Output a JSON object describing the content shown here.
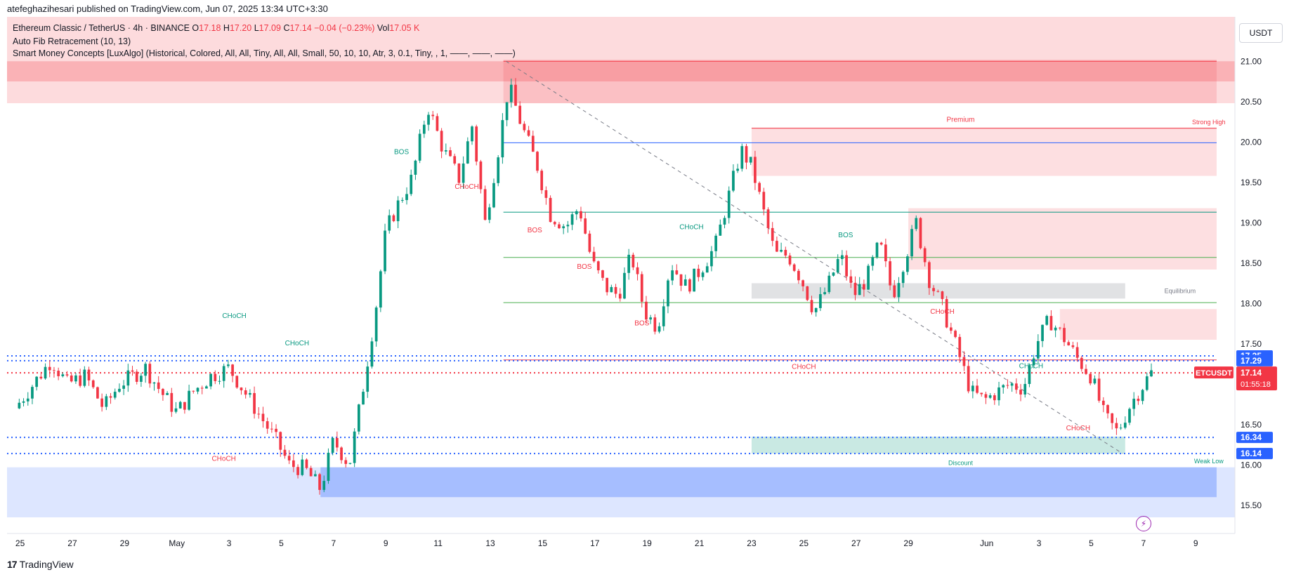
{
  "header": {
    "publisher": "atefeghazihesari published on TradingView.com, Jun 07, 2025 13:34 UTC+3:30"
  },
  "legend": {
    "symbol_line": "Ethereum Classic / TetherUS · 4h · BINANCE",
    "o_label": "O",
    "o_value": "17.18",
    "h_label": "H",
    "h_value": "17.20",
    "l_label": "L",
    "l_value": "17.09",
    "c_label": "C",
    "c_value": "17.14",
    "change": "−0.04 (−0.23%)",
    "vol_label": "Vol",
    "vol_value": "17.05 K",
    "indicator1": "Auto Fib Retracement (10, 13)",
    "indicator2": "Smart Money Concepts [LuxAlgo] (Historical, Colored, All, All, Tiny, All, All, Small, 50, 10, 10, Atr, 3, 0.1, Tiny, , 1, ——, ——, ——)"
  },
  "currency_button": "USDT",
  "brand": {
    "logo": "17",
    "name": "TradingView"
  },
  "colors": {
    "up": "#089981",
    "down": "#f23645",
    "fib": "#2962ff",
    "premium": "#f23645",
    "discount": "#089981"
  },
  "chart_data": {
    "type": "candlestick",
    "symbol": "ETCUSDT",
    "interval": "4h",
    "ylim": [
      15.15,
      21.55
    ],
    "y_ticks": [
      "15.50",
      "16.00",
      "16.50",
      "17.00",
      "17.50",
      "18.00",
      "18.50",
      "19.00",
      "19.50",
      "20.00",
      "20.50",
      "21.00"
    ],
    "x_ticks": [
      {
        "label": "25",
        "day": -5
      },
      {
        "label": "27",
        "day": -3
      },
      {
        "label": "29",
        "day": -1
      },
      {
        "label": "May",
        "day": 1
      },
      {
        "label": "3",
        "day": 3
      },
      {
        "label": "5",
        "day": 5
      },
      {
        "label": "7",
        "day": 7
      },
      {
        "label": "9",
        "day": 9
      },
      {
        "label": "11",
        "day": 11
      },
      {
        "label": "13",
        "day": 13
      },
      {
        "label": "15",
        "day": 15
      },
      {
        "label": "17",
        "day": 17
      },
      {
        "label": "19",
        "day": 19
      },
      {
        "label": "21",
        "day": 21
      },
      {
        "label": "23",
        "day": 23
      },
      {
        "label": "25",
        "day": 25
      },
      {
        "label": "27",
        "day": 27
      },
      {
        "label": "29",
        "day": 29
      },
      {
        "label": "Jun",
        "day": 32
      },
      {
        "label": "3",
        "day": 34
      },
      {
        "label": "5",
        "day": 36
      },
      {
        "label": "7",
        "day": 38
      },
      {
        "label": "9",
        "day": 40
      }
    ],
    "price_path": [
      [
        -5.2,
        16.7
      ],
      [
        -4.5,
        17.0
      ],
      [
        -3.8,
        17.3
      ],
      [
        -3.2,
        17.0
      ],
      [
        -2.5,
        17.1
      ],
      [
        -1.8,
        16.7
      ],
      [
        -1.2,
        17.0
      ],
      [
        -0.2,
        17.2
      ],
      [
        0.4,
        16.9
      ],
      [
        1.0,
        16.65
      ],
      [
        1.6,
        16.9
      ],
      [
        2.3,
        17.1
      ],
      [
        3.0,
        17.2
      ],
      [
        3.6,
        16.9
      ],
      [
        4.2,
        16.6
      ],
      [
        4.8,
        16.3
      ],
      [
        5.3,
        16.0
      ],
      [
        5.9,
        15.95
      ],
      [
        6.5,
        15.7
      ],
      [
        7.0,
        16.3
      ],
      [
        7.6,
        16.0
      ],
      [
        8.1,
        16.9
      ],
      [
        8.6,
        17.9
      ],
      [
        9.0,
        18.9
      ],
      [
        9.5,
        19.25
      ],
      [
        10.0,
        19.55
      ],
      [
        10.6,
        20.45
      ],
      [
        11.2,
        19.9
      ],
      [
        11.8,
        19.55
      ],
      [
        12.3,
        20.2
      ],
      [
        12.8,
        19.0
      ],
      [
        13.3,
        19.9
      ],
      [
        13.7,
        20.7
      ],
      [
        14.2,
        20.2
      ],
      [
        14.8,
        19.7
      ],
      [
        15.3,
        19.1
      ],
      [
        15.9,
        18.95
      ],
      [
        16.4,
        19.2
      ],
      [
        16.9,
        18.5
      ],
      [
        17.4,
        18.2
      ],
      [
        17.9,
        18.1
      ],
      [
        18.4,
        18.6
      ],
      [
        18.9,
        17.9
      ],
      [
        19.4,
        17.7
      ],
      [
        19.9,
        18.5
      ],
      [
        20.5,
        18.2
      ],
      [
        21.0,
        18.4
      ],
      [
        21.6,
        18.7
      ],
      [
        22.1,
        19.3
      ],
      [
        22.6,
        19.9
      ],
      [
        23.0,
        19.7
      ],
      [
        23.4,
        19.2
      ],
      [
        23.9,
        18.6
      ],
      [
        24.4,
        18.6
      ],
      [
        24.9,
        18.3
      ],
      [
        25.4,
        17.9
      ],
      [
        25.9,
        18.2
      ],
      [
        26.4,
        18.6
      ],
      [
        26.9,
        18.1
      ],
      [
        27.4,
        18.3
      ],
      [
        27.9,
        18.75
      ],
      [
        28.4,
        18.1
      ],
      [
        28.9,
        18.6
      ],
      [
        29.3,
        19.0
      ],
      [
        29.8,
        18.3
      ],
      [
        30.3,
        17.95
      ],
      [
        30.9,
        17.4
      ],
      [
        31.4,
        16.9
      ],
      [
        31.9,
        16.8
      ],
      [
        32.4,
        16.9
      ],
      [
        32.9,
        17.0
      ],
      [
        33.4,
        16.95
      ],
      [
        33.9,
        17.5
      ],
      [
        34.4,
        17.8
      ],
      [
        34.9,
        17.6
      ],
      [
        35.5,
        17.3
      ],
      [
        36.0,
        17.1
      ],
      [
        36.5,
        16.6
      ],
      [
        37.0,
        16.4
      ],
      [
        37.5,
        16.75
      ],
      [
        38.0,
        17.0
      ],
      [
        38.3,
        17.14
      ]
    ],
    "last_price": {
      "label": "ETCUSDT",
      "value": "17.14",
      "countdown": "01:55:18"
    },
    "price_tags": [
      {
        "value": "17.35",
        "y": 17.35
      },
      {
        "value": "17.29",
        "y": 17.29
      },
      {
        "value": "16.34",
        "y": 16.34
      },
      {
        "value": "16.14",
        "y": 16.14
      }
    ],
    "zones": [
      {
        "kind": "supply",
        "x0": 13.5,
        "x1": 40.8,
        "y0": 20.48,
        "y1": 21.02
      },
      {
        "kind": "supply",
        "x0": 23.0,
        "x1": 40.8,
        "y0": 19.58,
        "y1": 20.18
      },
      {
        "kind": "supply",
        "x0": 29.0,
        "x1": 40.8,
        "y0": 18.42,
        "y1": 19.18
      },
      {
        "kind": "supply",
        "x0": 34.8,
        "x1": 40.8,
        "y0": 17.55,
        "y1": 17.93
      },
      {
        "kind": "equilibrium",
        "x0": 23.0,
        "x1": 37.3,
        "y0": 18.06,
        "y1": 18.25
      },
      {
        "kind": "discount",
        "x0": 23.0,
        "x1": 37.3,
        "y0": 16.14,
        "y1": 16.35
      },
      {
        "kind": "demand",
        "x0": 6.5,
        "x1": 40.8,
        "y0": 15.6,
        "y1": 15.97
      }
    ],
    "levels": [
      {
        "y": 21.0,
        "x0": 13.5,
        "x1": 40.8,
        "color": "#f23645",
        "style": "solid"
      },
      {
        "y": 20.17,
        "x0": 23.0,
        "x1": 40.8,
        "color": "#f23645",
        "style": "solid"
      },
      {
        "y": 19.99,
        "x0": 13.5,
        "x1": 40.8,
        "color": "#2962ff",
        "style": "solid"
      },
      {
        "y": 19.13,
        "x0": 13.5,
        "x1": 40.8,
        "color": "#089981",
        "style": "solid"
      },
      {
        "y": 18.57,
        "x0": 13.5,
        "x1": 40.8,
        "color": "#4caf50",
        "style": "solid"
      },
      {
        "y": 18.01,
        "x0": 13.5,
        "x1": 40.8,
        "color": "#4caf50",
        "style": "solid"
      },
      {
        "y": 17.3,
        "x0": 13.5,
        "x1": 40.8,
        "color": "#f23645",
        "style": "solid"
      },
      {
        "y": 17.35,
        "x0": -5.5,
        "x1": 40.8,
        "color": "#2962ff",
        "style": "dotted"
      },
      {
        "y": 17.29,
        "x0": -5.5,
        "x1": 40.8,
        "color": "#2962ff",
        "style": "dotted"
      },
      {
        "y": 16.34,
        "x0": -5.5,
        "x1": 40.8,
        "color": "#2962ff",
        "style": "dotted"
      },
      {
        "y": 16.14,
        "x0": -5.5,
        "x1": 40.8,
        "color": "#2962ff",
        "style": "dotted"
      },
      {
        "y": 17.14,
        "x0": -5.5,
        "x1": 40.8,
        "color": "#f23645",
        "style": "dotted"
      }
    ],
    "diagonal": {
      "from": [
        13.6,
        21.0
      ],
      "to": [
        37.2,
        16.14
      ]
    },
    "annotations": [
      {
        "text": "CHoCH",
        "x": 3.2,
        "y": 17.82,
        "color": "#089981"
      },
      {
        "text": "CHoCH",
        "x": 5.6,
        "y": 17.48,
        "color": "#089981"
      },
      {
        "text": "CHoCH",
        "x": 2.8,
        "y": 16.05,
        "color": "#f23645"
      },
      {
        "text": "BOS",
        "x": 9.6,
        "y": 19.85,
        "color": "#089981"
      },
      {
        "text": "CHoCH",
        "x": 12.1,
        "y": 19.42,
        "color": "#f23645"
      },
      {
        "text": "BOS",
        "x": 14.7,
        "y": 18.88,
        "color": "#f23645"
      },
      {
        "text": "BOS",
        "x": 16.6,
        "y": 18.43,
        "color": "#f23645"
      },
      {
        "text": "BOS",
        "x": 18.8,
        "y": 17.73,
        "color": "#f23645"
      },
      {
        "text": "CHoCH",
        "x": 20.7,
        "y": 18.92,
        "color": "#089981"
      },
      {
        "text": "BOS",
        "x": 26.6,
        "y": 18.82,
        "color": "#089981"
      },
      {
        "text": "CHoCH",
        "x": 30.3,
        "y": 17.87,
        "color": "#f23645"
      },
      {
        "text": "CHoCH",
        "x": 25.0,
        "y": 17.19,
        "color": "#f23645"
      },
      {
        "text": "CHoCH",
        "x": 33.7,
        "y": 17.2,
        "color": "#089981"
      },
      {
        "text": "CHoCH",
        "x": 35.5,
        "y": 16.43,
        "color": "#f23645"
      },
      {
        "text": "Premium",
        "x": 31.0,
        "y": 20.25,
        "color": "#f23645"
      },
      {
        "text": "Equilibrium",
        "x": 39.4,
        "y": 18.13,
        "color": "#787b86"
      },
      {
        "text": "Discount",
        "x": 31.0,
        "y": 16.0,
        "color": "#089981"
      },
      {
        "text": "Strong High",
        "x": 40.5,
        "y": 20.22,
        "color": "#f23645"
      },
      {
        "text": "Weak Low",
        "x": 40.5,
        "y": 16.02,
        "color": "#089981"
      }
    ]
  }
}
